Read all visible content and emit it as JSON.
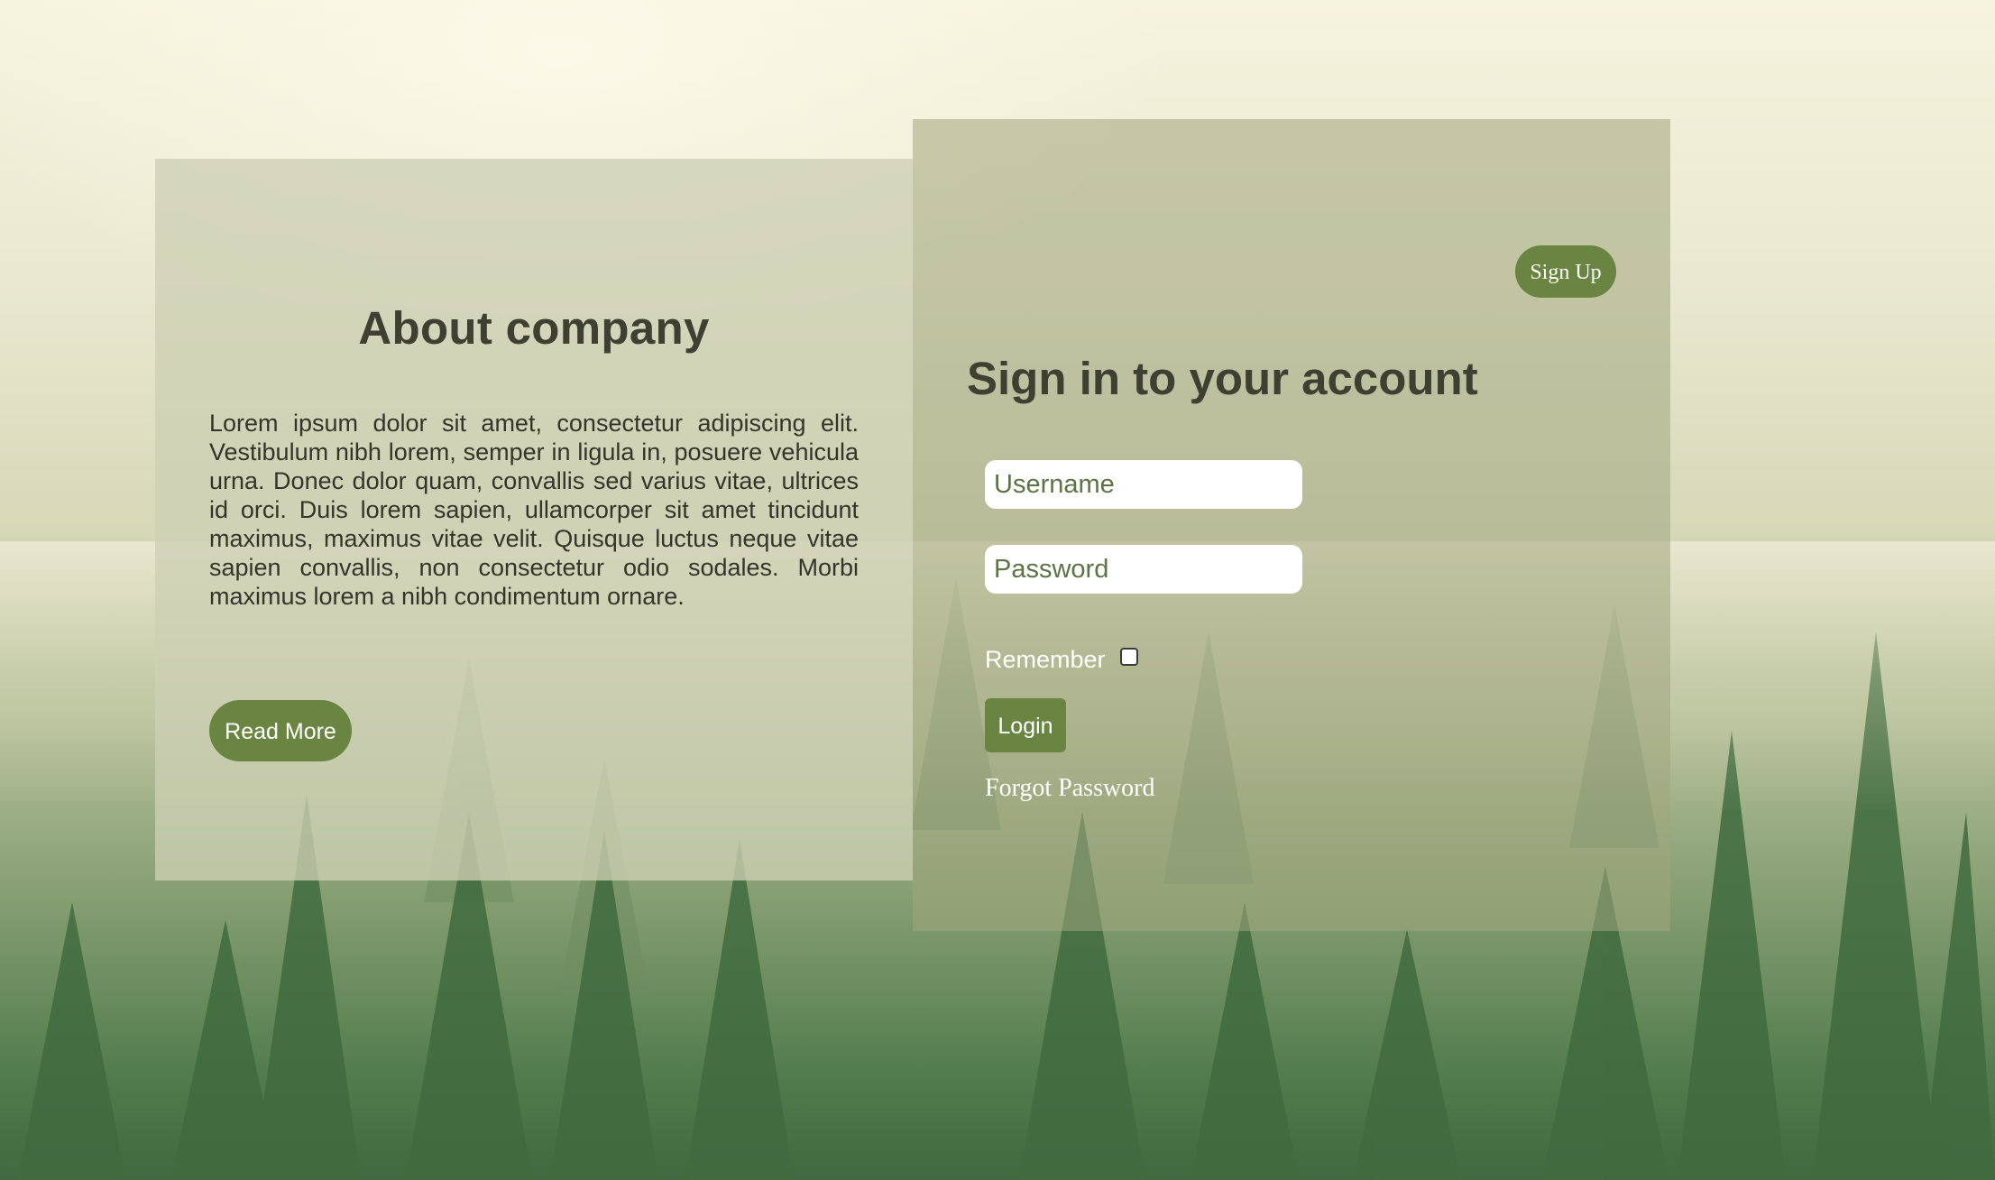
{
  "about": {
    "title": "About company",
    "body": "Lorem ipsum dolor sit amet, consectetur adipiscing elit. Vestibulum nibh lorem, semper in ligula in, posuere vehicula urna. Donec dolor quam, convallis sed varius vitae, ultrices id orci. Duis lorem sapien, ullamcorper sit amet tincidunt maximus, maximus vitae velit. Quisque luctus neque vitae sapien convallis, non consectetur odio sodales. Morbi maximus lorem a nibh condimentum ornare.",
    "read_more_label": "Read More"
  },
  "signin": {
    "signup_label": "Sign Up",
    "title": "Sign in to your account",
    "username_placeholder": "Username",
    "password_placeholder": "Password",
    "remember_label": "Remember",
    "remember_checked": false,
    "login_label": "Login",
    "forgot_label": "Forgot Password"
  },
  "theme": {
    "accent": "#6a8541",
    "heading_color": "#3e4032"
  },
  "background": {
    "icon": "foggy-forest-image"
  }
}
